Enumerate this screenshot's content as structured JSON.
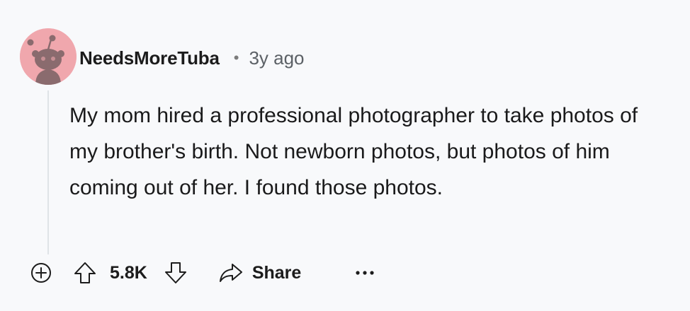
{
  "comment": {
    "author": {
      "username": "NeedsMoreTuba",
      "avatar_icon": "snoo-avatar-icon",
      "avatar_color": "#f0a7ad"
    },
    "separator": "•",
    "timestamp": "3y ago",
    "body": "My mom hired a professional photographer to take photos of my brother's birth. Not newborn photos, but photos of him coming out of her. I found those photos."
  },
  "actions": {
    "expand_icon": "plus-circle-icon",
    "upvote_icon": "upvote-arrow-icon",
    "score": "5.8K",
    "downvote_icon": "downvote-arrow-icon",
    "share_icon": "share-arrow-icon",
    "share_label": "Share",
    "more_icon": "ellipsis-icon"
  }
}
